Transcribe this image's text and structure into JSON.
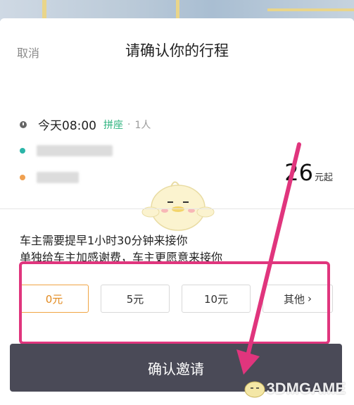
{
  "header": {
    "cancel_label": "取消",
    "title": "请确认你的行程"
  },
  "trip": {
    "time": "今天08:00",
    "mode": "拼座",
    "separator": "·",
    "passengers": "1人",
    "price_value": "26",
    "price_unit": "元起",
    "colors": {
      "carpool": "#2cb37e",
      "start_dot": "#2bb5a8",
      "end_dot": "#f0a050"
    }
  },
  "notes": {
    "line1": "车主需要提早1小时30分钟来接你",
    "line2": "单独给车主加感谢费，车主更愿意来接你"
  },
  "fees": {
    "options": [
      "0元",
      "5元",
      "10元",
      "其他"
    ],
    "selected": "0元"
  },
  "confirm": {
    "label": "确认邀请",
    "color": "#4a4a57"
  },
  "annotation": {
    "color": "#e0357d"
  },
  "watermark": {
    "text": "3DMGAME"
  }
}
